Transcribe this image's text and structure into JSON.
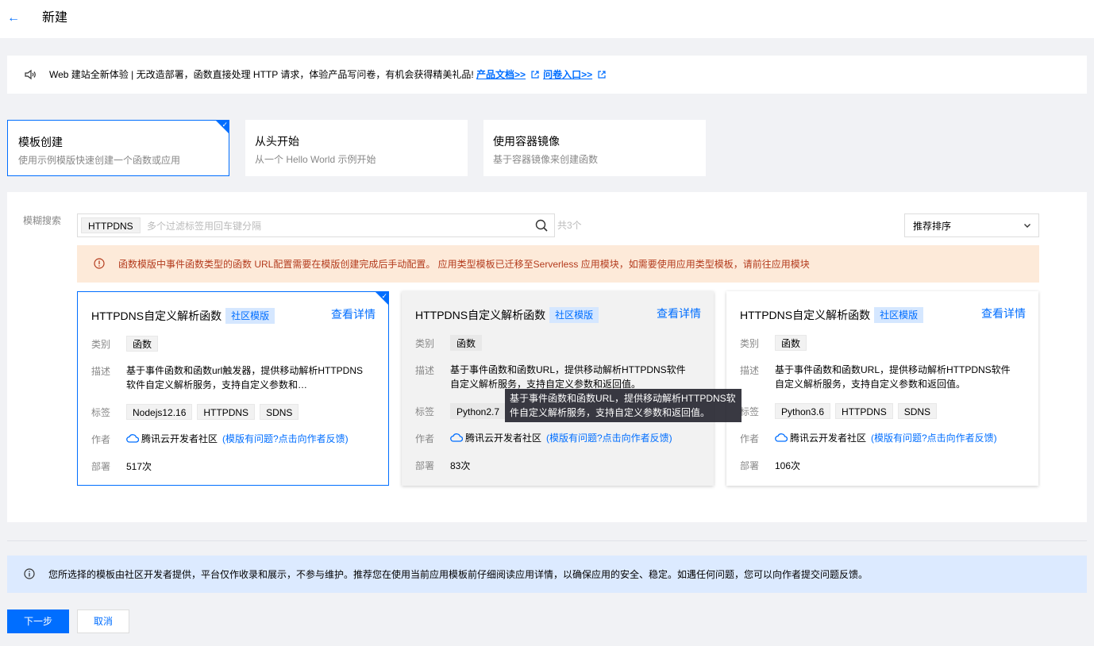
{
  "header": {
    "back_icon": "arrow-left-icon",
    "title": "新建"
  },
  "notice": {
    "text": "Web 建站全新体验 | 无改造部署，函数直接处理 HTTP 请求，体验产品写问卷，有机会获得精美礼品!",
    "link_docs": "产品文档>>",
    "link_survey": "问卷入口>>"
  },
  "modes": [
    {
      "title": "模板创建",
      "desc": "使用示例模版快速创建一个函数或应用"
    },
    {
      "title": "从头开始",
      "desc": "从一个 Hello World 示例开始"
    },
    {
      "title": "使用容器镜像",
      "desc": "基于容器镜像来创建函数"
    }
  ],
  "filter": {
    "label": "模糊搜索",
    "chip": "HTTPDNS",
    "placeholder": "多个过滤标签用回车键分隔",
    "count": "共3个",
    "sort": "推荐排序"
  },
  "warning": "函数模版中事件函数类型的函数 URL配置需要在模版创建完成后手动配置。 应用类型模板已迁移至Serverless 应用模块，如需要使用应用类型模板，请前往应用模块",
  "labels": {
    "category": "类别",
    "desc": "描述",
    "tags": "标签",
    "author": "作者",
    "deploy": "部署"
  },
  "cards": [
    {
      "title": "HTTPDNS自定义解析函数",
      "badge": "社区模版",
      "detail": "查看详情",
      "category": "函数",
      "desc": "基于事件函数和函数url触发器，提供移动解析HTTPDNS软件自定义解析服务，支持自定义参数和…",
      "tags": [
        "Nodejs12.16",
        "HTTPDNS",
        "SDNS"
      ],
      "author": "腾讯云开发者社区",
      "feedback": "(模版有问题?点击向作者反馈)",
      "deploy": "517次"
    },
    {
      "title": "HTTPDNS自定义解析函数",
      "badge": "社区模版",
      "detail": "查看详情",
      "category": "函数",
      "desc": "基于事件函数和函数URL，提供移动解析HTTPDNS软件自定义解析服务，支持自定义参数和返回值。",
      "tags": [
        "Python2.7"
      ],
      "author": "腾讯云开发者社区",
      "feedback": "(模版有问题?点击向作者反馈)",
      "deploy": "83次"
    },
    {
      "title": "HTTPDNS自定义解析函数",
      "badge": "社区模版",
      "detail": "查看详情",
      "category": "函数",
      "desc": "基于事件函数和函数URL，提供移动解析HTTPDNS软件自定义解析服务，支持自定义参数和返回值。",
      "tags": [
        "Python3.6",
        "HTTPDNS",
        "SDNS"
      ],
      "author": "腾讯云开发者社区",
      "feedback": "(模版有问题?点击向作者反馈)",
      "deploy": "106次"
    }
  ],
  "tooltip": "基于事件函数和函数URL，提供移动解析HTTPDNS软件自定义解析服务，支持自定义参数和返回值。",
  "info": "您所选择的模板由社区开发者提供，平台仅作收录和展示，不参与维护。推荐您在使用当前应用模板前仔细阅读应用详情，以确保应用的安全、稳定。如遇任何问题，您可以向作者提交问题反馈。",
  "buttons": {
    "next": "下一步",
    "cancel": "取消"
  },
  "colors": {
    "primary": "#006eff",
    "warning_bg": "#fdead9",
    "info_bg": "#dceaff"
  }
}
